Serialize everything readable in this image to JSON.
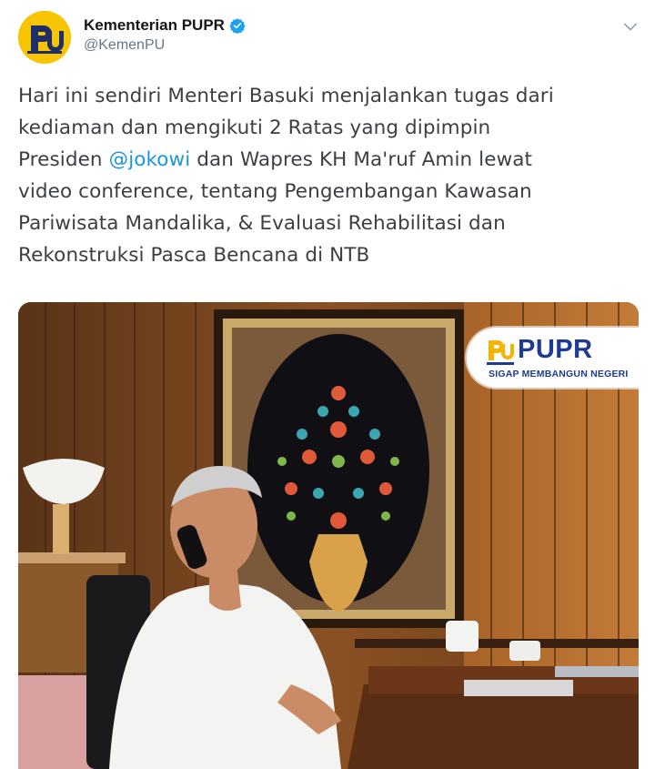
{
  "author": {
    "display_name": "Kementerian PUPR",
    "handle": "@KemenPU",
    "verified": true,
    "avatar_icon": "pupr-logo",
    "avatar_color": "#f6c400"
  },
  "tweet": {
    "lines": [
      "Hari ini sendiri Menteri Basuki menjalankan tugas dari",
      "kediaman dan mengikuti 2 Ratas yang dipimpin",
      "dan Wapres KH Ma'ruf Amin lewat",
      "video conference, tentang Pengembangan Kawasan",
      "Pariwisata Mandalika, & Evaluasi  Rehabilitasi dan",
      "Rekonstruksi Pasca Bencana di NTB"
    ],
    "line3_prefix": "Presiden ",
    "mention": "@jokowi",
    "mention_color": "#1b95e0"
  },
  "photo": {
    "logo_text": "PUPR",
    "logo_tagline": "SIGAP MEMBANGUN NEGERI",
    "logo_color": "#1f3a93",
    "logo_accent": "#f6b400"
  },
  "menu": {
    "icon": "chevron-down-icon"
  }
}
